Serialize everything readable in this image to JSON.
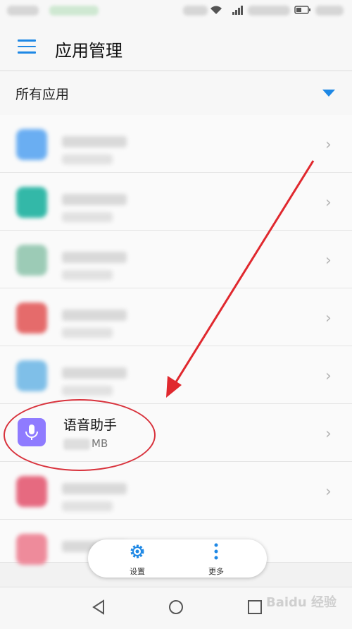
{
  "header": {
    "title": "应用管理"
  },
  "filter": {
    "label": "所有应用"
  },
  "apps": [
    {
      "icon_color": "#6aaef2"
    },
    {
      "icon_color": "#33b8a8"
    },
    {
      "icon_color": "#9ccbb6"
    },
    {
      "icon_color": "#e56b6b"
    },
    {
      "icon_color": "#7fbfe8"
    },
    {
      "name": "语音助手",
      "size_unit": "MB",
      "icon_color": "#8f7bff",
      "icon": "microphone-icon"
    },
    {
      "icon_color": "#e66a80"
    },
    {
      "icon_color": "#ee8b9b"
    }
  ],
  "toolbar": {
    "settings_label": "设置",
    "more_label": "更多"
  },
  "watermark": "Baidu 经验"
}
